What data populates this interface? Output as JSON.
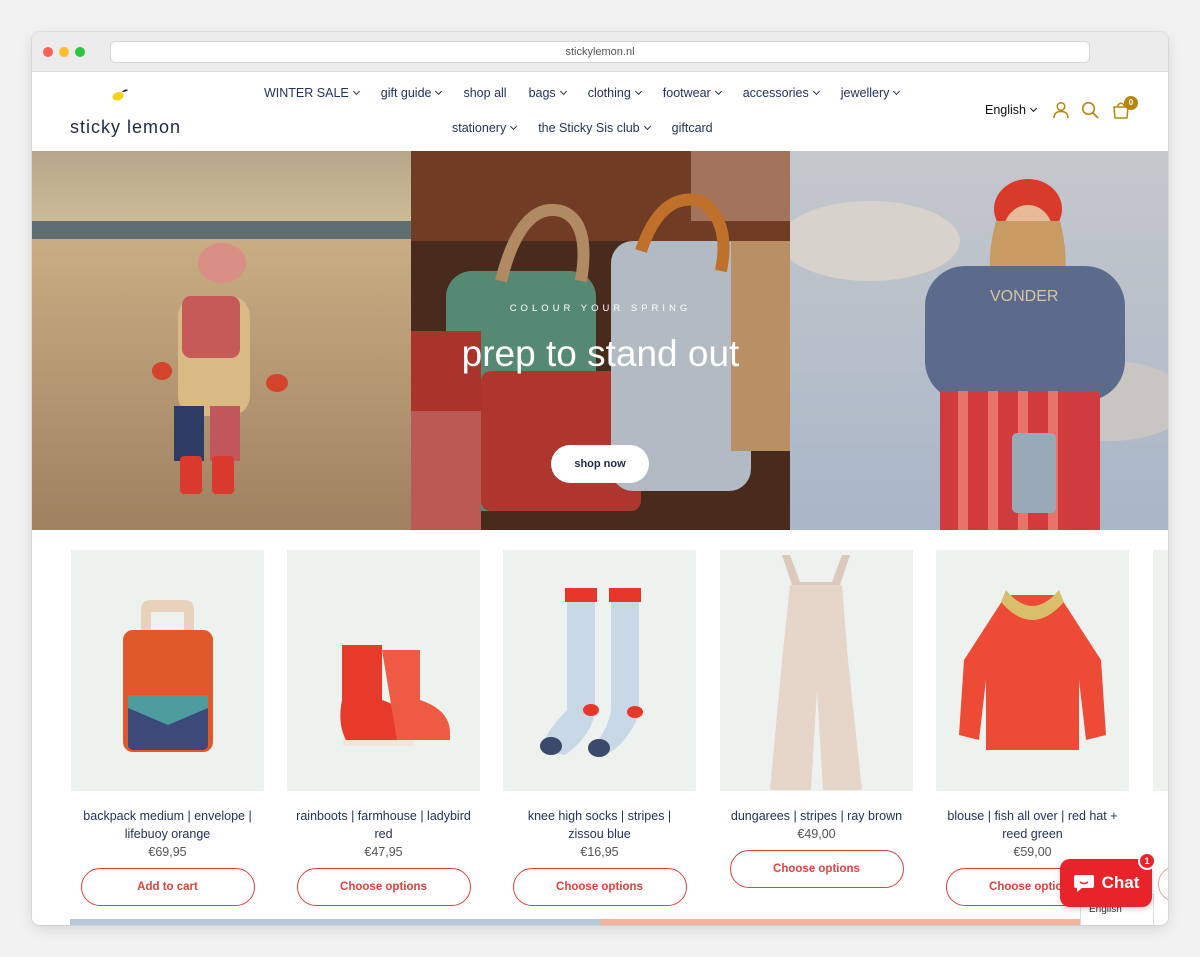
{
  "browser": {
    "url": "stickylemon.nl"
  },
  "brand": {
    "name": "sticky lemon"
  },
  "nav": {
    "row1": [
      {
        "label": "WINTER SALE",
        "dropdown": true
      },
      {
        "label": "gift guide",
        "dropdown": true
      },
      {
        "label": "shop all",
        "dropdown": false
      },
      {
        "label": "bags",
        "dropdown": true
      },
      {
        "label": "clothing",
        "dropdown": true
      },
      {
        "label": "footwear",
        "dropdown": true
      },
      {
        "label": "accessories",
        "dropdown": true
      },
      {
        "label": "jewellery",
        "dropdown": true
      }
    ],
    "row2": [
      {
        "label": "stationery",
        "dropdown": true
      },
      {
        "label": "the Sticky Sis club",
        "dropdown": true
      },
      {
        "label": "giftcard",
        "dropdown": false
      }
    ]
  },
  "header": {
    "language": "English",
    "cart_count": "0",
    "icons": [
      "account-icon",
      "search-icon",
      "cart-icon"
    ],
    "accent_color": "#b8860b"
  },
  "hero": {
    "kicker": "COLOUR YOUR SPRING",
    "headline": "prep to stand out",
    "button": "shop now"
  },
  "products": [
    {
      "title": "backpack medium | envelope | lifebuoy orange",
      "price": "€69,95",
      "button": "Add to cart"
    },
    {
      "title": "rainboots | farmhouse | ladybird red",
      "price": "€47,95",
      "button": "Choose options"
    },
    {
      "title": "knee high socks | stripes | zissou blue",
      "price": "€16,95",
      "button": "Choose options"
    },
    {
      "title": "dungarees | stripes | ray brown",
      "price": "€49,00",
      "button": "Choose options"
    },
    {
      "title": "blouse | fish all over | red hat + reed green",
      "price": "€59,00",
      "button": "Choose options"
    }
  ],
  "chat": {
    "label": "Chat",
    "badge": "1",
    "color": "#e8232a"
  },
  "language_widget": {
    "label": "English"
  }
}
